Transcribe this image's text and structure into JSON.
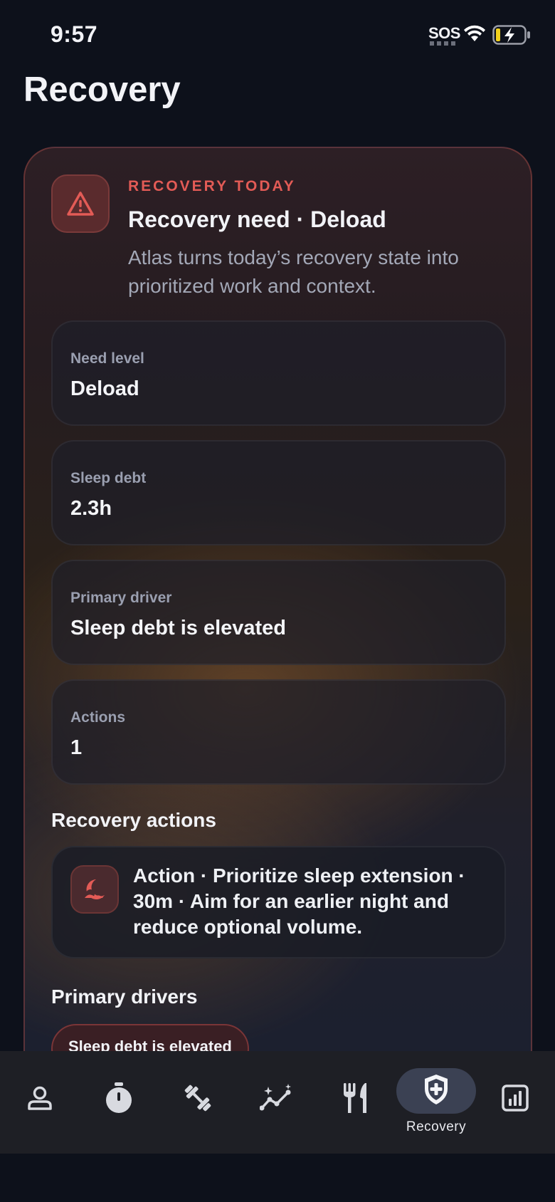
{
  "status_bar": {
    "time": "9:57",
    "sos": "SOS"
  },
  "page": {
    "title": "Recovery"
  },
  "hero": {
    "eyebrow": "RECOVERY TODAY",
    "title": "Recovery need · Deload",
    "description": "Atlas turns today’s recovery state into prioritized work and context.",
    "icon": "warning-triangle-icon",
    "accent_color": "#e35b56"
  },
  "stats": [
    {
      "label": "Need level",
      "value": "Deload"
    },
    {
      "label": "Sleep debt",
      "value": "2.3h"
    },
    {
      "label": "Primary driver",
      "value": "Sleep debt is elevated"
    },
    {
      "label": "Actions",
      "value": "1"
    }
  ],
  "actions_section": {
    "title": "Recovery actions",
    "items": [
      {
        "icon": "moon-icon",
        "text": "Action · Prioritize sleep extension · 30m · Aim for an earlier night and reduce optional volume."
      }
    ]
  },
  "drivers_section": {
    "title": "Primary drivers",
    "chips": [
      "Sleep debt is elevated"
    ]
  },
  "tab_bar": {
    "tabs": [
      {
        "icon": "person-icon",
        "active": false
      },
      {
        "icon": "stopwatch-icon",
        "active": false
      },
      {
        "icon": "dumbbell-icon",
        "active": false
      },
      {
        "icon": "trend-sparkle-icon",
        "active": false
      },
      {
        "icon": "fork-knife-icon",
        "active": false
      },
      {
        "icon": "shield-plus-icon",
        "active": true,
        "label": "Recovery"
      },
      {
        "icon": "bar-chart-icon",
        "active": false
      }
    ]
  }
}
